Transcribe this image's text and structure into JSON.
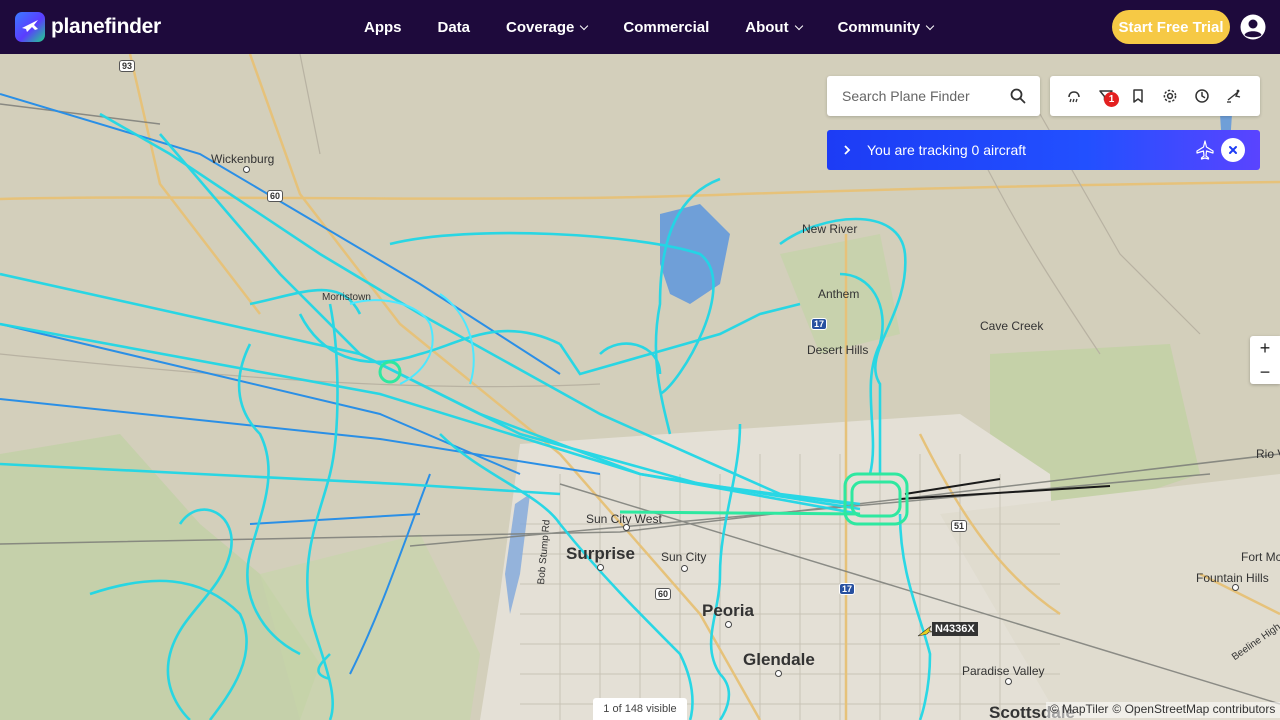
{
  "header": {
    "brand": "planefinder",
    "nav": [
      {
        "label": "Apps",
        "dropdown": false
      },
      {
        "label": "Data",
        "dropdown": false
      },
      {
        "label": "Coverage",
        "dropdown": true
      },
      {
        "label": "Commercial",
        "dropdown": false
      },
      {
        "label": "About",
        "dropdown": true
      },
      {
        "label": "Community",
        "dropdown": true
      }
    ],
    "cta_label": "Start Free Trial",
    "colors": {
      "bar": "#1e0a3c",
      "cta": "#f6c945"
    }
  },
  "search": {
    "placeholder": "Search Plane Finder"
  },
  "toolbar": {
    "icons": [
      "weather-icon",
      "filter-icon",
      "bookmark-icon",
      "settings-icon",
      "history-icon",
      "playback-icon"
    ],
    "filter_badge": "1"
  },
  "tracking": {
    "text": "You are tracking 0 aircraft"
  },
  "zoom": {
    "in": "+",
    "out": "−"
  },
  "map": {
    "places": [
      {
        "name": "Wickenburg",
        "size": "small"
      },
      {
        "name": "New River",
        "size": "small"
      },
      {
        "name": "Anthem",
        "size": "small"
      },
      {
        "name": "Cave Creek",
        "size": "small"
      },
      {
        "name": "Desert Hills",
        "size": "small"
      },
      {
        "name": "Sun City West",
        "size": "small"
      },
      {
        "name": "Surprise",
        "size": "big"
      },
      {
        "name": "Sun City",
        "size": "small"
      },
      {
        "name": "Peoria",
        "size": "big"
      },
      {
        "name": "Glendale",
        "size": "big"
      },
      {
        "name": "Paradise Valley",
        "size": "small"
      },
      {
        "name": "Fountain Hills",
        "size": "small"
      },
      {
        "name": "Fort Mc",
        "size": "small"
      },
      {
        "name": "Rio Ve",
        "size": "small"
      },
      {
        "name": "Scottsdale",
        "size": "big"
      },
      {
        "name": "Bob Stump Rd",
        "size": "small"
      },
      {
        "name": "Beeline High",
        "size": "small"
      },
      {
        "name": "Morristown",
        "size": "small"
      }
    ],
    "shields": [
      "93",
      "60",
      "17",
      "51",
      "60",
      "17"
    ],
    "aircraft_label": "N4336X"
  },
  "visible_count": "1 of 148 visible",
  "attribution": {
    "maptiler": "© MapTiler",
    "osm": "© OpenStreetMap contributors"
  }
}
